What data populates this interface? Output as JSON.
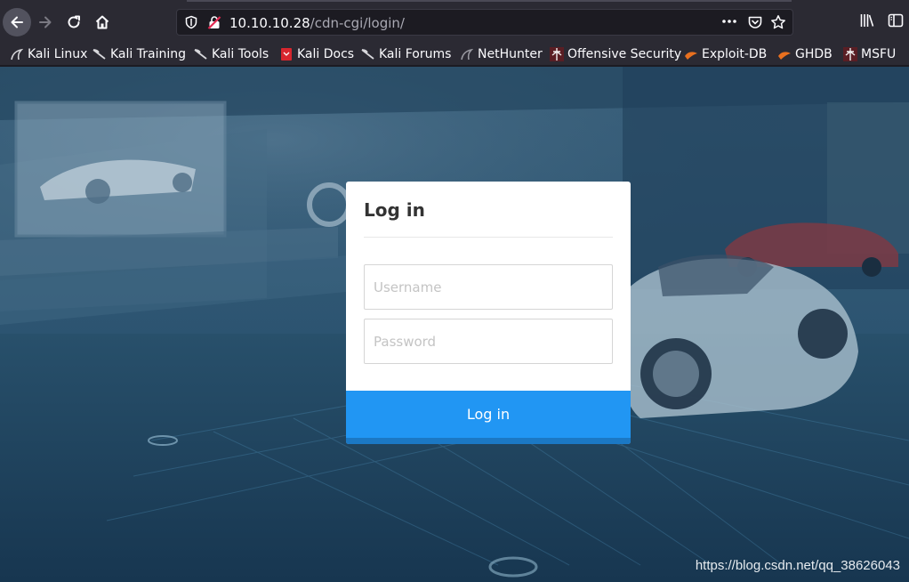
{
  "browser": {
    "url_host": "10.10.10.28",
    "url_path": "/cdn-cgi/login/",
    "page_actions_icon": "ellipsis-icon",
    "bookmarks": [
      {
        "label": "Kali Linux",
        "icon": "kali-dragon-icon"
      },
      {
        "label": "Kali Training",
        "icon": "kali-dragon-icon"
      },
      {
        "label": "Kali Tools",
        "icon": "kali-dragon-icon"
      },
      {
        "label": "Kali Docs",
        "icon": "kali-docs-icon"
      },
      {
        "label": "Kali Forums",
        "icon": "kali-dragon-icon"
      },
      {
        "label": "NetHunter",
        "icon": "nethunter-icon"
      },
      {
        "label": "Offensive Security",
        "icon": "offsec-icon"
      },
      {
        "label": "Exploit-DB",
        "icon": "exploitdb-icon"
      },
      {
        "label": "GHDB",
        "icon": "exploitdb-icon"
      },
      {
        "label": "MSFU",
        "icon": "offsec-icon"
      }
    ]
  },
  "login": {
    "title": "Log in",
    "username_placeholder": "Username",
    "password_placeholder": "Password",
    "submit_label": "Log in"
  },
  "watermark": "https://blog.csdn.net/qq_38626043",
  "colors": {
    "accent": "#2196f3",
    "accent_dark": "#1b78c4",
    "toolbar_bg": "#2b2a33",
    "background_tint": "#2c5671"
  }
}
